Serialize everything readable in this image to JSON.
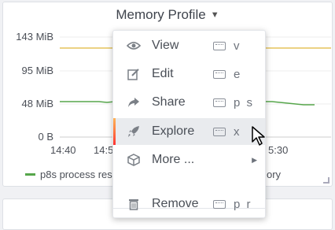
{
  "panel": {
    "title": "Memory Profile",
    "y_ticks": [
      "143 MiB",
      "95 MiB",
      "48 MiB",
      "0 B"
    ],
    "x_ticks_visible": [
      "14:40",
      "14:5",
      "5:30"
    ],
    "legend_left": "p8s process res",
    "legend_right": "ory",
    "colors": {
      "series_green": "#56a64b",
      "series_yellow": "#e5c35a"
    }
  },
  "menu": {
    "items": [
      {
        "label": "View",
        "shortcut": "v",
        "icon": "eye-icon"
      },
      {
        "label": "Edit",
        "shortcut": "e",
        "icon": "edit-icon"
      },
      {
        "label": "Share",
        "shortcut": "p s",
        "icon": "share-icon"
      },
      {
        "label": "Explore",
        "shortcut": "x",
        "icon": "rocket-icon"
      },
      {
        "label": "More ...",
        "shortcut": "",
        "icon": "cube-icon"
      },
      {
        "label": "Remove",
        "shortcut": "p r",
        "icon": "trash-icon"
      }
    ],
    "active": "Explore"
  }
}
